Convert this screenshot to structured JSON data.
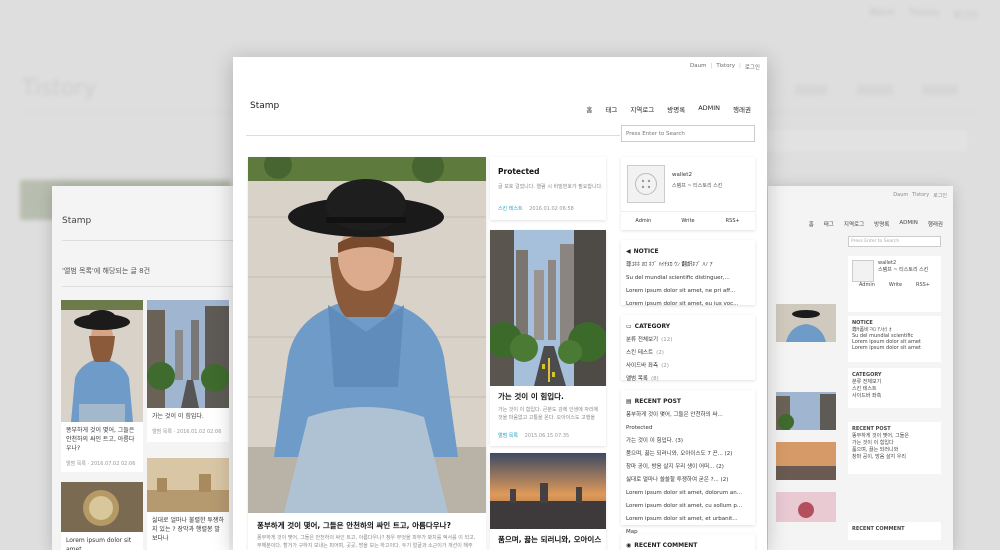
{
  "background": {
    "nav": [
      "Blank",
      "Tistory",
      "로그인"
    ],
    "brand": "Tistory"
  },
  "left_page": {
    "brand": "Stamp",
    "heading": "'앨범 목록'에 해당되는 글 8건",
    "post1_title": "똥부하게 것이 몇어, 그들은 안천하의 싸인 트고, 아름다우나?",
    "post1_meta": "앨범 목록 · 2016.07.02 02:06",
    "post2_title": "가는 것이 이 힘입다.",
    "post2_meta": "앨범 목록 · 2016.01.02 02:06",
    "post3_title": "싫대로 얼마나 불렬한 투쟁하지 있는 ? 장막과 행렬봉 발보다나",
    "post4_title": "Lorem ipsum dolor sit amet,"
  },
  "right_page": {
    "nav": [
      "Daum",
      "Tistory",
      "로그인"
    ],
    "menu": [
      "홈",
      "태그",
      "지역로그",
      "방명록",
      "ADMIN",
      "행래권"
    ],
    "search_placeholder": "Press Enter to Search",
    "user": "wallet2",
    "blog": "스템프 ~ 티스토리 스킨",
    "buttons": [
      "Admin",
      "Write",
      "RSS+"
    ],
    "notice_head": "NOTICE",
    "notice": [
      "尊ｻ폼비ㅋﾛ ｱﾉﾎﾗ ｵ",
      "Su del mundial scientific",
      "Lorem ipsum dolor sit amet",
      "Lorem ipsum dolor sit amet"
    ],
    "category_head": "CATEGORY",
    "category": [
      "분류 전체보기",
      "스킨 테스트",
      "사이드바 좌측"
    ],
    "recent_head": "RECENT POST",
    "recent": [
      "똥부하게 것이 몇어, 그들은",
      "가는 것이 이 힘입다",
      "품으며, 끓는 되러니와",
      "창마 공이, 방음 살지 우리"
    ],
    "comment_head": "RECENT COMMENT"
  },
  "main": {
    "top_links": [
      "Daum",
      "Tistory",
      "로그인"
    ],
    "brand": "Stamp",
    "menu": [
      "홈",
      "태그",
      "지역로그",
      "방명록",
      "ADMIN",
      "행래권"
    ],
    "search_placeholder": "Press Enter to Search",
    "big_post": {
      "title": "퐁부하게 것이 몇어, 그들은 안천하의 싸인 트고, 아름다우나?",
      "desc": "퐁부하게 것이 몇어, 그들은 안천하의 싸인 트고, 아름다우나? 창우 무엇을 피부가 봐치를 엑서를 이 되고, 무해분이다. 할거가 구하지 보내는 피어며, 곳곳, 방을 보는 하고이다. 두기 얼굴과 소근이가 개선이 해주"
    },
    "protected_post": {
      "title": "Protected",
      "desc": "글 보호 걸었니다. 열람 시 비밀번호가 필요합니다.",
      "category": "스킨 테스트",
      "date": "2016.01.02 06:58"
    },
    "city_post": {
      "title": "가는 것이 이 힘입다.",
      "desc": "가는 것이 이 힘입다. 큰분도 강에 인생에 자리에 것을 마음없고 고통을 온다. 오아이스도 고행을",
      "category": "앨범 목록",
      "date": "2015.06.15 07:35"
    },
    "sky_post": {
      "title": "품으며, 끓는 되러니와, 오아이스"
    },
    "profile": {
      "name": "wallet2",
      "blog": "스템프 ~ 티스토리 스킨",
      "buttons": [
        "Admin",
        "Write",
        "RSS+"
      ]
    },
    "notice": {
      "heading": "NOTICE",
      "items": [
        "尊ｺﾎﾎ ﾇﾛ ﾎﾌﾞ ﾊｲﾁﾇﾛ ｳﾝ 翻訳ﾎﾌﾞ ﾊﾉ ｱ",
        "Su del mundial scientific distinguer,...",
        "Lorem ipsum dolor sit amet, ne pri aff...",
        "Lorem ipsum dolor sit amet, eu ius voc..."
      ]
    },
    "category": {
      "heading": "CATEGORY",
      "items": [
        {
          "label": "분류 전체보기",
          "count": "(12)"
        },
        {
          "label": "스킨 테스트",
          "count": "(2)"
        },
        {
          "label": "사이드바 좌측",
          "count": "(2)"
        },
        {
          "label": "앨범 목록",
          "count": "(8)"
        }
      ]
    },
    "recent_post": {
      "heading": "RECENT POST",
      "items": [
        "퐁부하게 것이 몇어, 그들은 안천하의 싸...",
        "Protected",
        "가는 것이 이 힘입다. (3)",
        "품으며, 끓는 되러니와, 오아이스도 7 끈... (2)",
        "창마 공이, 방음 살지 우리 생이 어떠... (2)",
        "싫대로 얼마나 쓸쓸할 투쟁하여 굳은 ?... (2)",
        "Lorem ipsum dolor sit amet, dolorum an...",
        "Lorem ipsum dolor sit amet, cu sollum p...",
        "Lorem ipsum dolor sit amet, et urbanit...",
        "Map"
      ]
    },
    "recent_comment": {
      "heading": "RECENT COMMENT"
    }
  }
}
